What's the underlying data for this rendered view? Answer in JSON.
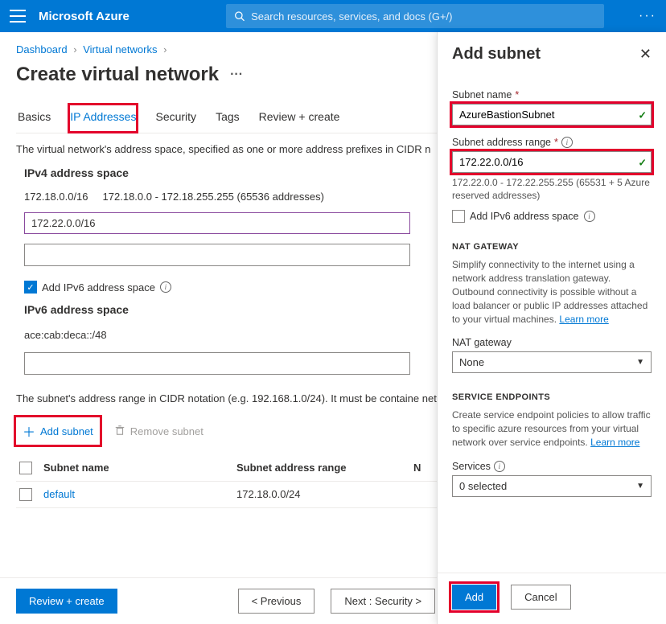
{
  "header": {
    "brand": "Microsoft Azure",
    "search_placeholder": "Search resources, services, and docs (G+/)"
  },
  "breadcrumb": {
    "items": [
      "Dashboard",
      "Virtual networks"
    ]
  },
  "page_title": "Create virtual network",
  "tabs": [
    "Basics",
    "IP Addresses",
    "Security",
    "Tags",
    "Review + create"
  ],
  "active_tab": "IP Addresses",
  "ipv4_desc": "The virtual network's address space, specified as one or more address prefixes in CIDR n",
  "ipv4_section_label": "IPv4 address space",
  "ipv4_rows": [
    {
      "cidr": "172.18.0.0/16",
      "range": "172.18.0.0 - 172.18.255.255 (65536 addresses)"
    }
  ],
  "ipv4_input_value": "172.22.0.0/16",
  "add_ipv6_label": "Add IPv6 address space",
  "ipv6_section_label": "IPv6 address space",
  "ipv6_value": "ace:cab:deca::/48",
  "subnet_desc": "The subnet's address range in CIDR notation (e.g. 192.168.1.0/24). It must be containe  network.",
  "add_subnet_label": "Add subnet",
  "remove_subnet_label": "Remove subnet",
  "subnet_table": {
    "headers": [
      "Subnet name",
      "Subnet address range",
      "N"
    ],
    "rows": [
      {
        "name": "default",
        "range": "172.18.0.0/24"
      }
    ]
  },
  "footer": {
    "review": "Review + create",
    "previous": "< Previous",
    "next": "Next : Security >"
  },
  "panel": {
    "title": "Add subnet",
    "subnet_name_label": "Subnet name",
    "subnet_name_value": "AzureBastionSubnet",
    "subnet_range_label": "Subnet address range",
    "subnet_range_value": "172.22.0.0/16",
    "subnet_range_hint": "172.22.0.0 - 172.22.255.255 (65531 + 5 Azure reserved addresses)",
    "add_ipv6_label": "Add IPv6 address space",
    "nat_header": "NAT GATEWAY",
    "nat_body": "Simplify connectivity to the internet using a network address translation gateway. Outbound connectivity is possible without a load balancer or public IP addresses attached to your virtual machines.",
    "learn_more": "Learn more",
    "nat_label": "NAT gateway",
    "nat_value": "None",
    "se_header": "SERVICE ENDPOINTS",
    "se_body": "Create service endpoint policies to allow traffic to specific azure resources from your virtual network over service endpoints.",
    "services_label": "Services",
    "services_value": "0 selected",
    "add_btn": "Add",
    "cancel_btn": "Cancel"
  }
}
